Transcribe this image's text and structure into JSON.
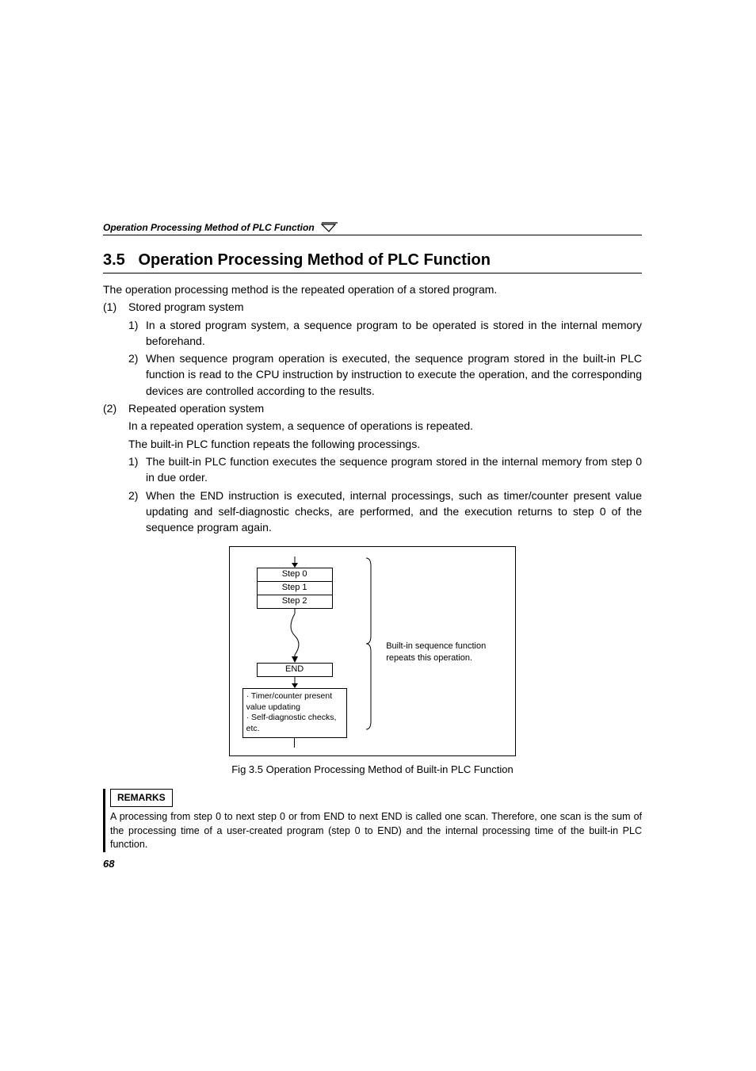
{
  "running_head": "Operation Processing Method of PLC Function",
  "section_number": "3.5",
  "section_title": "Operation Processing Method of PLC Function",
  "intro": "The operation processing method is the repeated operation of a stored program.",
  "item1": {
    "num": "(1)",
    "title": "Stored program system",
    "sub1": {
      "num": "1)",
      "text": "In a stored program system, a sequence program to be operated is stored in the internal memory beforehand."
    },
    "sub2": {
      "num": "2)",
      "text": "When sequence program operation is executed, the sequence program stored in the built-in PLC function is read to the CPU instruction by instruction to execute the operation, and the corresponding devices are controlled according to the results."
    }
  },
  "item2": {
    "num": "(2)",
    "title": "Repeated operation system",
    "line1": "In a repeated operation system, a sequence of operations is repeated.",
    "line2": "The built-in PLC function repeats the following processings.",
    "sub1": {
      "num": "1)",
      "text": "The built-in PLC function executes the sequence program stored in the internal memory from step 0 in due order."
    },
    "sub2": {
      "num": "2)",
      "text": "When the END instruction is executed, internal processings, such as timer/counter present value updating and self-diagnostic checks, are performed, and the execution returns to step 0 of the sequence program again."
    }
  },
  "figure": {
    "step0": "Step 0",
    "step1": "Step 1",
    "step2": "Step 2",
    "end": "END",
    "proc_line1": "· Timer/counter present value updating",
    "proc_line2": "· Self-diagnostic checks, etc.",
    "right_text": "Built-in sequence function repeats this operation.",
    "caption": "Fig 3.5 Operation Processing Method of Built-in PLC Function"
  },
  "remarks": {
    "label": "REMARKS",
    "text": "A processing from step 0 to next step 0 or from END to next END is called one scan. Therefore, one scan is the sum of the processing time of a user-created program (step 0 to END) and the internal processing time of the built-in PLC function."
  },
  "page_number": "68"
}
